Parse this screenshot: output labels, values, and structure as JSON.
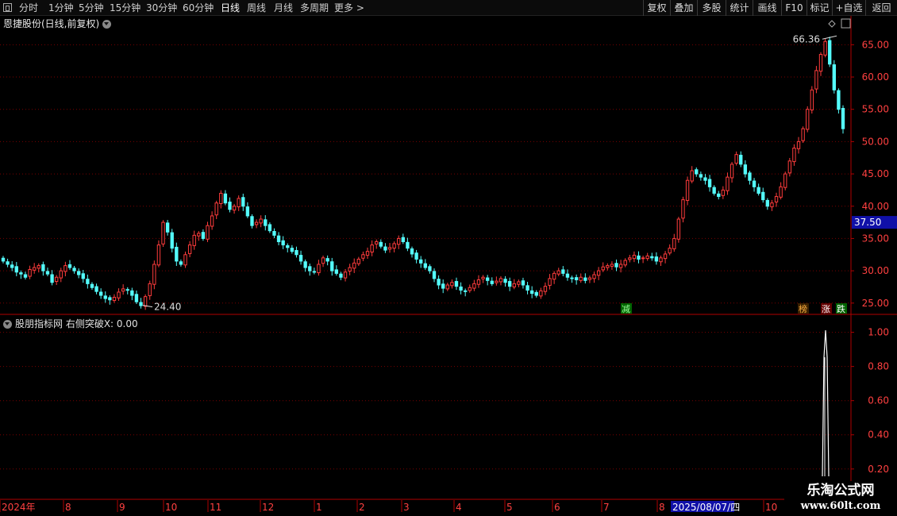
{
  "toolbar": {
    "periods": [
      "分时",
      "1分钟",
      "5分钟",
      "15分钟",
      "30分钟",
      "60分钟",
      "日线",
      "周线",
      "月线",
      "多周期",
      "更多 >"
    ],
    "active_period": "日线",
    "right_buttons": [
      "复权",
      "叠加",
      "多股",
      "统计",
      "画线",
      "F10",
      "+自选",
      "返回",
      "标记"
    ]
  },
  "price_panel": {
    "title": "恩捷股份(日线,前复权)",
    "y_ticks": [
      "65.00",
      "60.00",
      "55.00",
      "50.00",
      "45.00",
      "40.00",
      "35.00",
      "30.00",
      "25.00"
    ],
    "current_price_label": "37.50",
    "high_label": "66.36",
    "low_label": "24.40",
    "markers": [
      "减",
      "榜",
      "涨",
      "跌"
    ]
  },
  "indicator_panel": {
    "title": "股朋指标网  右侧突破X: 0.00",
    "y_ticks": [
      "1.00",
      "0.80",
      "0.60",
      "0.40",
      "0.20"
    ]
  },
  "time_axis": {
    "labels": [
      "2024年",
      "8",
      "9",
      "10",
      "11",
      "12",
      "1",
      "2",
      "3",
      "4",
      "5",
      "6",
      "7",
      "8",
      "10"
    ],
    "cursor_date": "2025/08/07/四"
  },
  "watermark": {
    "title": "乐淘公式网",
    "url": "www.60lt.com"
  },
  "colors": {
    "up": "#ff3c3c",
    "down": "#54fcfc",
    "grid": "#7a0000",
    "axis": "#b00000",
    "price_tag_bg": "#1010a8"
  },
  "chart_data": {
    "type": "candlestick",
    "ylim": [
      23.5,
      67.5
    ],
    "key_values": {
      "high": 66.36,
      "low": 24.4,
      "last": 37.5
    },
    "close_series": [
      31.5,
      31.0,
      30.5,
      29.8,
      29.5,
      29.0,
      30.2,
      30.5,
      30.8,
      30.0,
      29.5,
      28.2,
      29.0,
      30.0,
      30.8,
      30.5,
      30.0,
      29.4,
      28.8,
      28.0,
      27.4,
      26.8,
      26.2,
      25.7,
      25.5,
      25.9,
      26.7,
      27.2,
      27.0,
      26.2,
      25.2,
      24.6,
      26.0,
      28.0,
      31.0,
      34.0,
      37.5,
      36.0,
      33.5,
      31.5,
      31.0,
      32.5,
      34.0,
      35.5,
      35.8,
      35.0,
      37.0,
      38.5,
      40.5,
      42.0,
      40.5,
      39.5,
      40.0,
      41.2,
      40.0,
      38.5,
      37.0,
      37.5,
      38.0,
      37.0,
      36.2,
      35.5,
      34.5,
      34.0,
      33.6,
      33.0,
      32.5,
      31.5,
      30.5,
      30.0,
      29.8,
      31.0,
      32.0,
      31.5,
      30.0,
      29.6,
      29.0,
      29.8,
      30.5,
      31.2,
      31.8,
      32.5,
      33.0,
      34.0,
      34.5,
      33.8,
      33.2,
      33.6,
      34.2,
      35.0,
      34.5,
      33.5,
      32.6,
      31.8,
      31.2,
      30.5,
      30.0,
      28.8,
      27.8,
      27.3,
      27.8,
      28.2,
      27.6,
      27.0,
      26.8,
      27.4,
      28.0,
      28.6,
      29.0,
      28.5,
      28.0,
      28.4,
      28.8,
      28.2,
      27.6,
      28.0,
      28.3,
      27.8,
      27.0,
      26.5,
      26.2,
      26.9,
      27.6,
      28.8,
      29.6,
      30.0,
      29.6,
      29.0,
      28.8,
      28.6,
      29.0,
      28.5,
      28.9,
      29.4,
      30.0,
      30.6,
      30.8,
      31.0,
      30.6,
      31.0,
      31.6,
      32.0,
      32.4,
      31.8,
      32.0,
      32.3,
      32.0,
      31.5,
      32.0,
      32.6,
      33.5,
      35.0,
      38.0,
      41.0,
      44.0,
      45.5,
      45.0,
      44.5,
      44.0,
      43.0,
      42.0,
      41.5,
      42.5,
      44.5,
      46.5,
      48.0,
      46.5,
      45.0,
      44.0,
      43.0,
      42.0,
      41.0,
      40.0,
      40.5,
      41.5,
      43.0,
      45.0,
      47.0,
      49.0,
      50.0,
      52.0,
      55.0,
      58.0,
      61.0,
      63.5,
      65.5,
      62.0,
      58.0,
      55.0,
      52.0
    ]
  }
}
